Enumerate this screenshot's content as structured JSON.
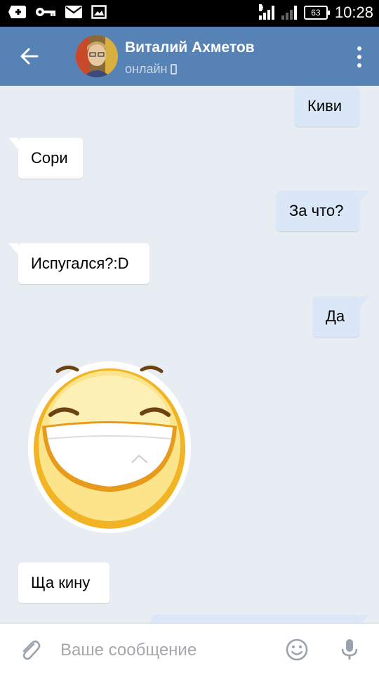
{
  "status_bar": {
    "time": "10:28",
    "battery_level": "63",
    "signal_label": "H"
  },
  "header": {
    "contact_name": "Виталий Ахметов",
    "contact_status": "онлайн"
  },
  "messages": [
    {
      "text": "Киви",
      "direction": "outgoing"
    },
    {
      "text": "Сори",
      "direction": "incoming"
    },
    {
      "text": "За что?",
      "direction": "outgoing"
    },
    {
      "text": "Испугался?:D",
      "direction": "incoming"
    },
    {
      "text": "Да",
      "direction": "outgoing"
    },
    {
      "type": "sticker",
      "sticker": "laughing-smiley",
      "direction": "incoming"
    },
    {
      "text": "Ща кину",
      "direction": "incoming"
    }
  ],
  "input": {
    "placeholder": "Ваше сообщение"
  },
  "colors": {
    "header": "#5682b5",
    "chat_background": "#e8edf3",
    "incoming_bubble": "#ffffff",
    "outgoing_bubble": "#d9e7f7"
  }
}
